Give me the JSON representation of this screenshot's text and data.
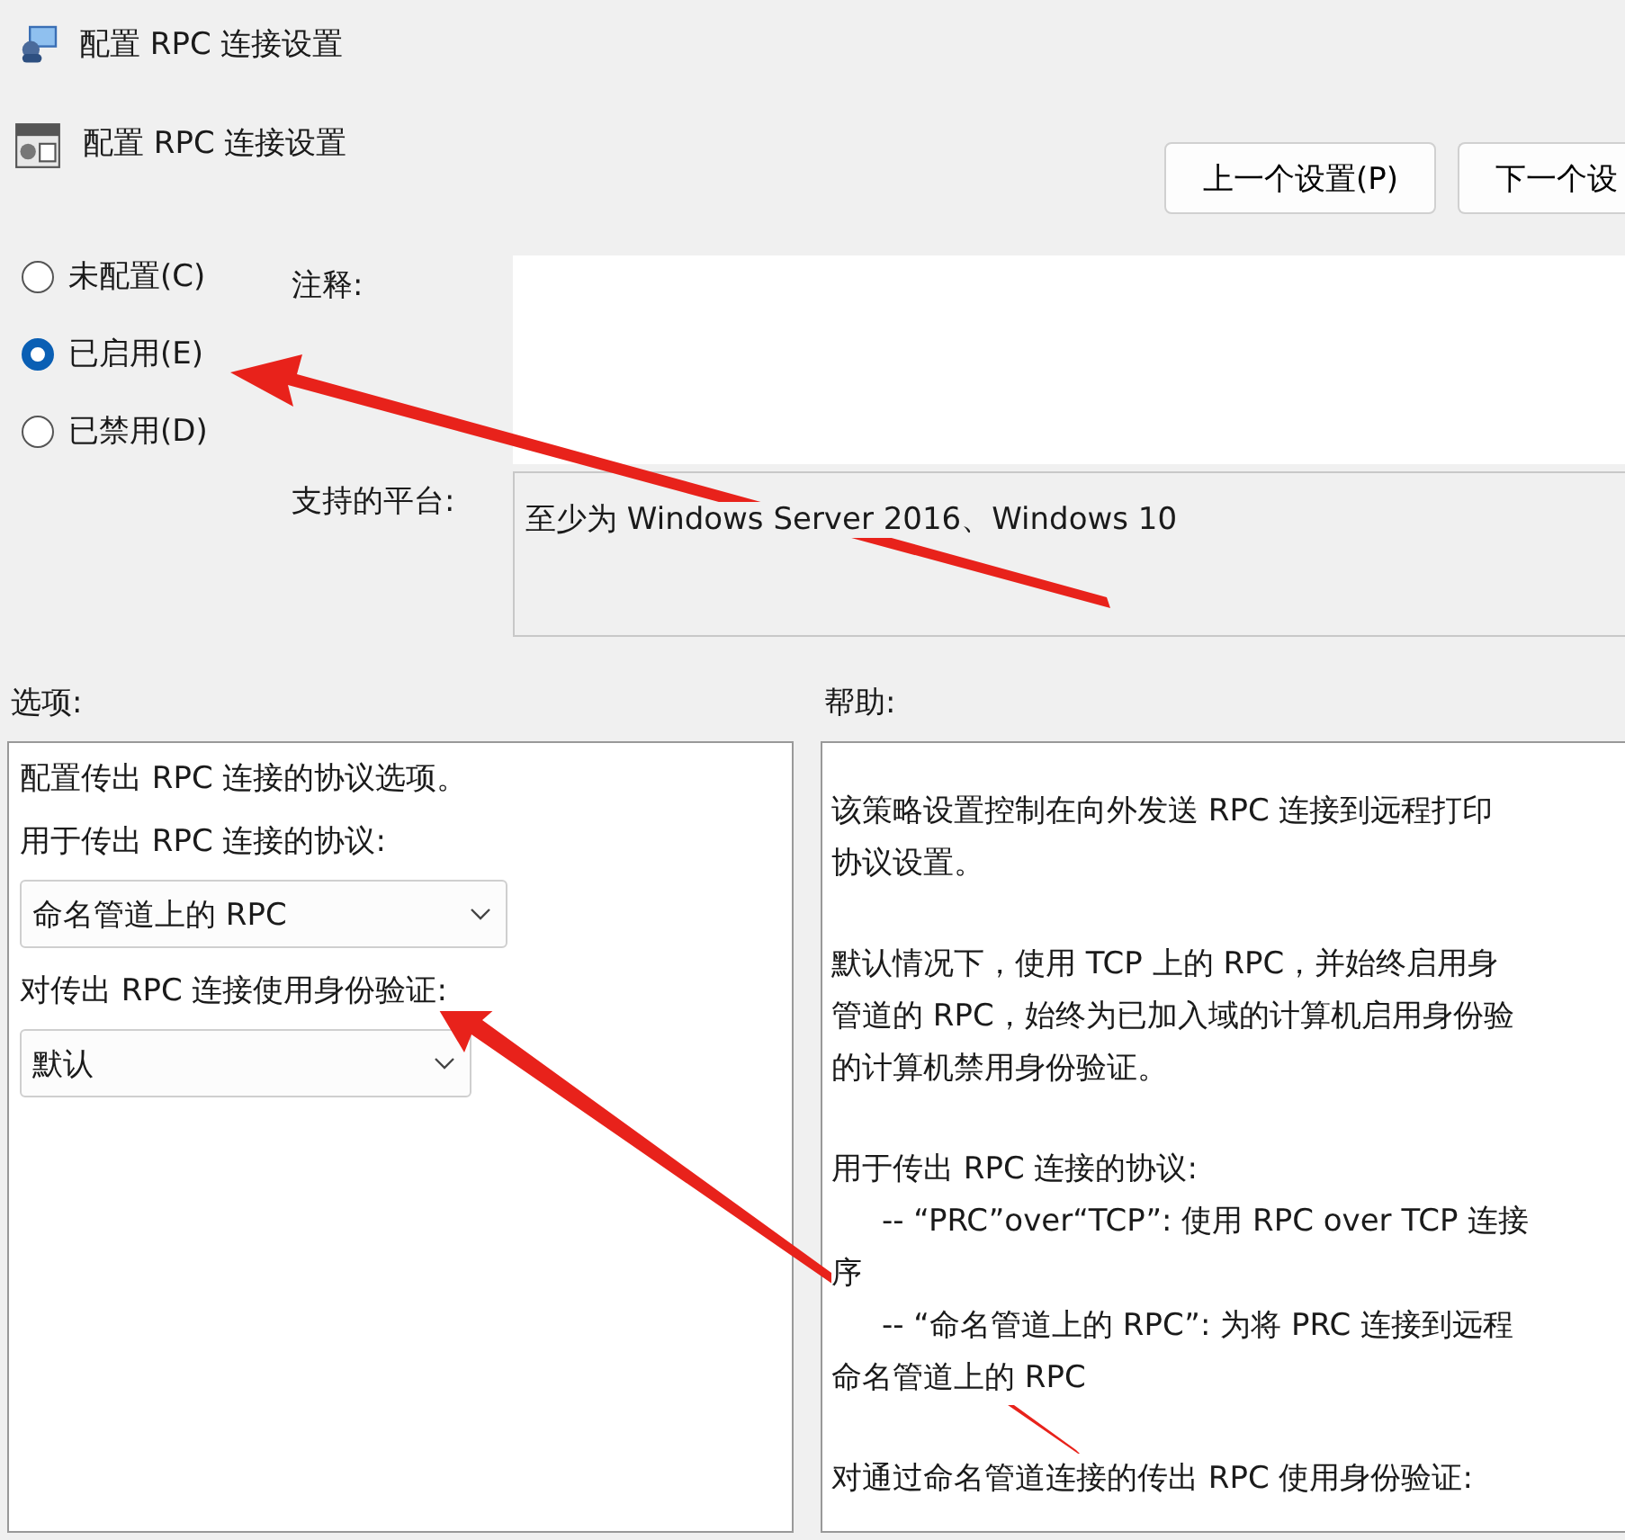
{
  "window": {
    "title": "配置 RPC 连接设置"
  },
  "header": {
    "title": "配置 RPC 连接设置"
  },
  "nav_buttons": [
    {
      "label": "上一个设置(P)"
    },
    {
      "label": "下一个设"
    }
  ],
  "state_options": [
    {
      "label": "未配置(C)",
      "selected": false
    },
    {
      "label": "已启用(E)",
      "selected": true
    },
    {
      "label": "已禁用(D)",
      "selected": false
    }
  ],
  "comment": {
    "label": "注释:"
  },
  "platform": {
    "label": "支持的平台:",
    "value": "至少为 Windows Server 2016、Windows 10"
  },
  "options": {
    "label": "选项:",
    "description": "配置传出 RPC 连接的协议选项。",
    "fields": [
      {
        "label": "用于传出 RPC 连接的协议:",
        "value": "命名管道上的 RPC"
      },
      {
        "label": "对传出 RPC 连接使用身份验证:",
        "value": "默认"
      }
    ]
  },
  "help": {
    "label": "帮助:",
    "paragraphs": [
      [
        {
          "text": "该策略设置控制在向外发送 RPC 连接到远程打印",
          "indent": false
        },
        {
          "text": "协议设置。",
          "indent": false
        }
      ],
      [
        {
          "text": "默认情况下，使用 TCP 上的 RPC，并始终启用身",
          "indent": false
        },
        {
          "text": "管道的 RPC，始终为已加入域的计算机启用身份验",
          "indent": false
        },
        {
          "text": "的计算机禁用身份验证。",
          "indent": false
        }
      ],
      [
        {
          "text": "用于传出 RPC 连接的协议:",
          "indent": false
        },
        {
          "text": "-- “PRC”over“TCP”: 使用 RPC over TCP 连接",
          "indent": true
        },
        {
          "text": "序",
          "indent": false
        },
        {
          "text": "-- “命名管道上的 RPC”: 为将 PRC 连接到远程",
          "indent": true
        },
        {
          "text": "命名管道上的 RPC",
          "indent": false
        }
      ],
      [
        {
          "text": "对通过命名管道连接的传出 RPC 使用身份验证:",
          "indent": false
        }
      ]
    ]
  }
}
